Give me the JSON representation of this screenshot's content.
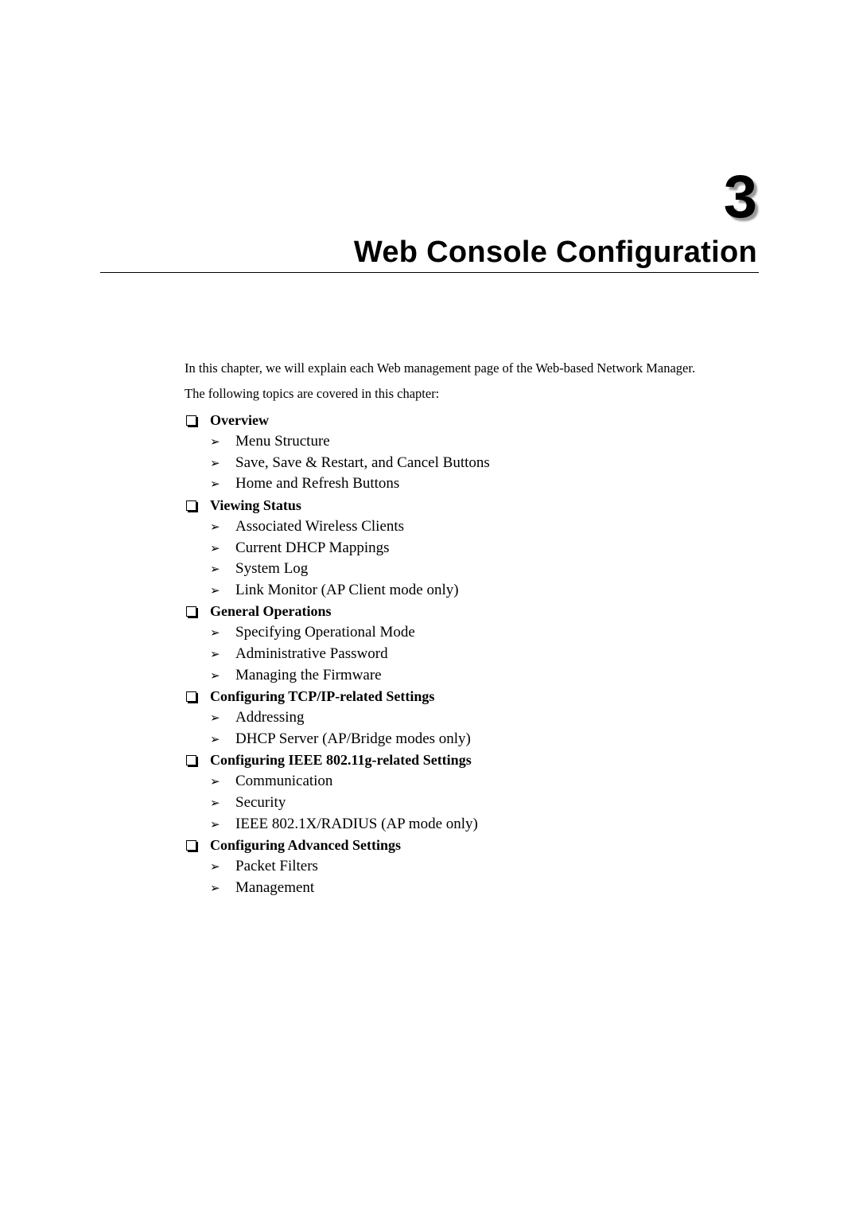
{
  "chapter": {
    "number": "3",
    "title": "Web Console Configuration"
  },
  "intro": {
    "line1": "In this chapter, we will explain each Web management page of the Web-based Network Manager.",
    "line2": "The following topics are covered in this chapter:"
  },
  "icons": {
    "section_bullet": "checkbox-square-icon",
    "item_bullet": "arrowhead-icon",
    "arrow_glyph": "➢"
  },
  "sections": [
    {
      "title": "Overview",
      "items": [
        "Menu Structure",
        "Save, Save & Restart, and Cancel Buttons",
        "Home and Refresh Buttons"
      ]
    },
    {
      "title": "Viewing Status",
      "items": [
        "Associated Wireless Clients",
        "Current DHCP Mappings",
        "System Log",
        "Link Monitor (AP Client mode only)"
      ]
    },
    {
      "title": "General Operations",
      "items": [
        "Specifying Operational Mode",
        "Administrative Password",
        "Managing the Firmware"
      ]
    },
    {
      "title": "Configuring TCP/IP-related Settings",
      "items": [
        "Addressing",
        "DHCP Server (AP/Bridge modes only)"
      ]
    },
    {
      "title": "Configuring IEEE 802.11g-related Settings",
      "items": [
        "Communication",
        "Security",
        "IEEE 802.1X/RADIUS (AP mode only)"
      ]
    },
    {
      "title": "Configuring Advanced Settings",
      "items": [
        "Packet Filters",
        "Management"
      ]
    }
  ]
}
